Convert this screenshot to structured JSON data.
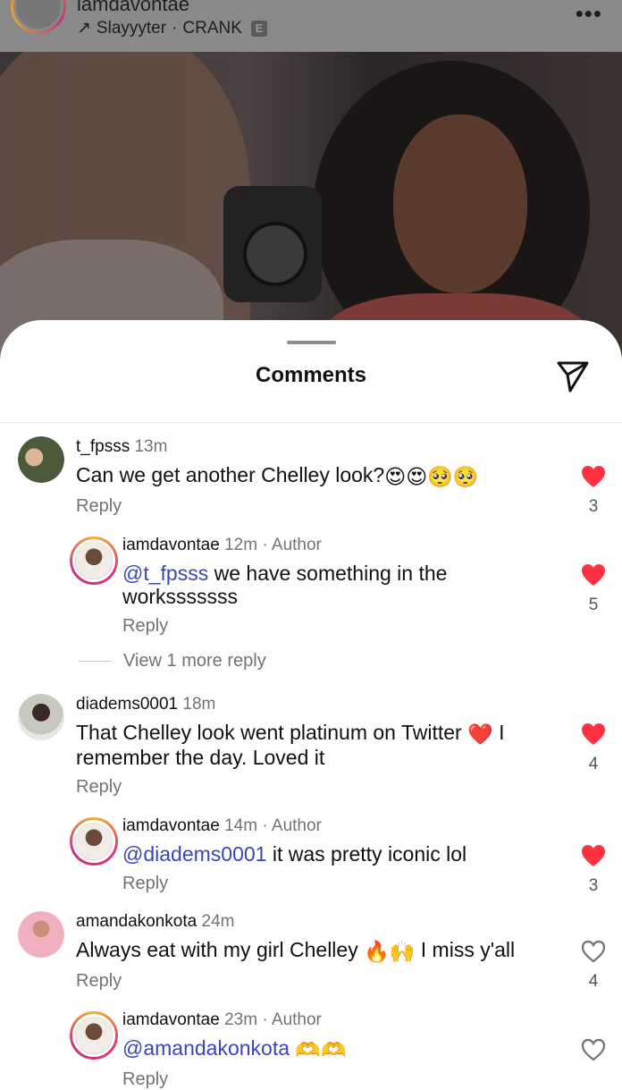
{
  "post_header": {
    "username": "iamdavontae",
    "audio_artist": "Slayyyter",
    "audio_separator": "·",
    "audio_title": "CRANK",
    "explicit_badge": "E",
    "more_icon": "more-dots-icon"
  },
  "sheet": {
    "title": "Comments",
    "share_icon": "send-icon"
  },
  "comments": [
    {
      "username": "t_fpsss",
      "time": "13m",
      "text": "Can we get another Chelley look?",
      "emojis": "😍😍🥺🥺",
      "reply_label": "Reply",
      "liked": true,
      "like_count": "3"
    },
    {
      "username": "iamdavontae",
      "time": "12m",
      "author_label": "Author",
      "mention": "@t_fpsss",
      "text": "we have something in the worksssssss",
      "reply_label": "Reply",
      "liked": true,
      "like_count": "5"
    },
    {
      "view_more": "View 1 more reply"
    },
    {
      "username": "diadems0001",
      "time": "18m",
      "text_before": "That Chelley look went platinum on Twitter",
      "emoji": "❤️",
      "text_after": "I remember the day. Loved it",
      "reply_label": "Reply",
      "liked": true,
      "like_count": "4"
    },
    {
      "username": "iamdavontae",
      "time": "14m",
      "author_label": "Author",
      "mention": "@diadems0001",
      "text": "it was pretty iconic lol",
      "reply_label": "Reply",
      "liked": true,
      "like_count": "3"
    },
    {
      "username": "amandakonkota",
      "time": "24m",
      "text_before": "Always eat with my girl Chelley",
      "emoji": "🔥🙌",
      "text_after": "I miss y'all",
      "reply_label": "Reply",
      "liked": false,
      "like_count": "4"
    },
    {
      "username": "iamdavontae",
      "time": "23m",
      "author_label": "Author",
      "mention": "@amandakonkota",
      "emojis": "🫶🫶",
      "reply_label": "Reply",
      "liked": false
    }
  ],
  "colors": {
    "like_red": "#ff3040",
    "mention_blue": "#3a45b8",
    "muted_gray": "#737373"
  }
}
